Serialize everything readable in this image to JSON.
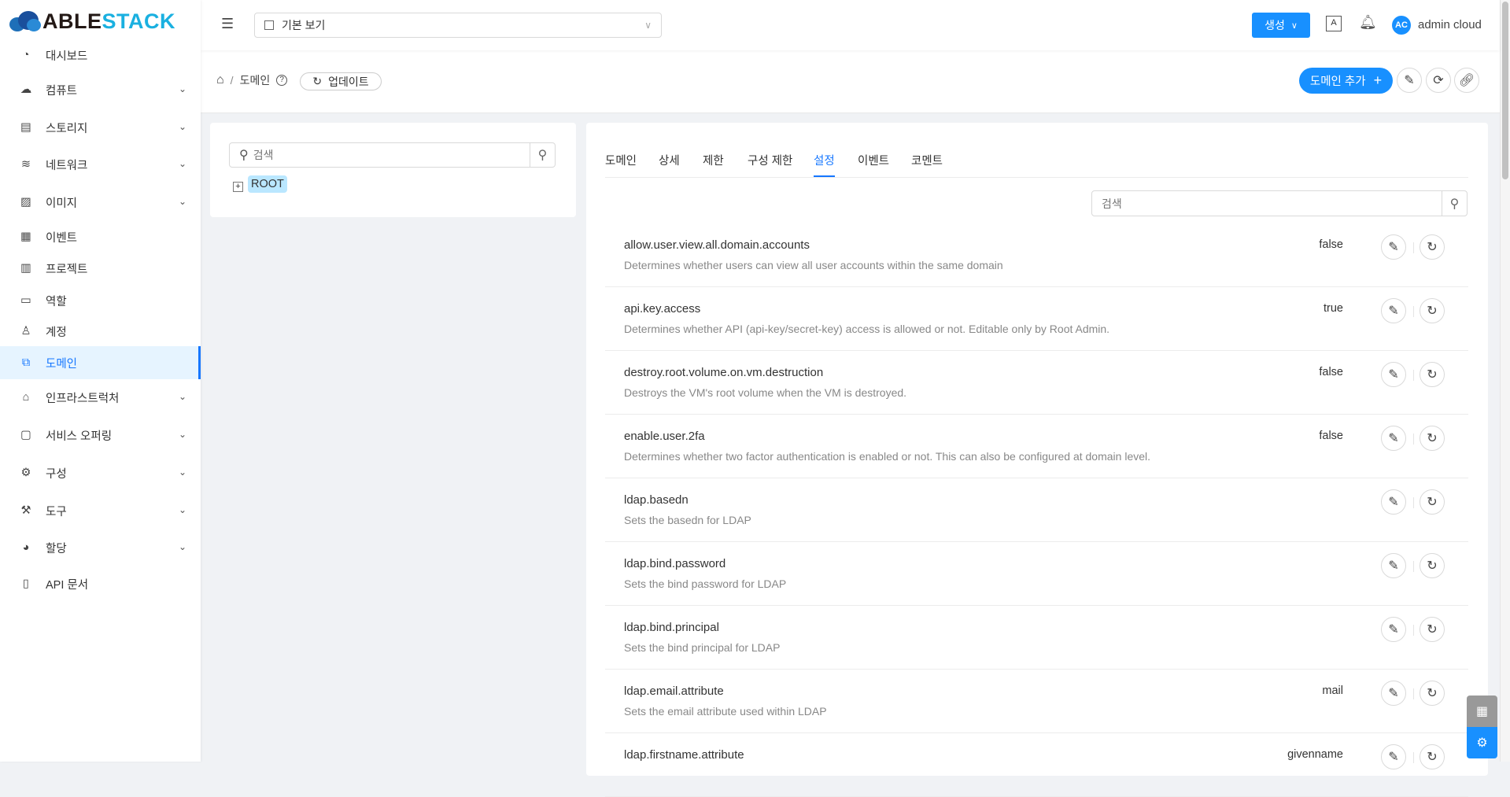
{
  "logo": {
    "part1": "ABLE",
    "part2": "STACK"
  },
  "sidebar": {
    "items": [
      {
        "label": "대시보드",
        "icon": "dashboard-icon",
        "chevron": false
      },
      {
        "label": "컴퓨트",
        "icon": "cloud-icon",
        "chevron": true
      },
      {
        "label": "스토리지",
        "icon": "storage-icon",
        "chevron": true
      },
      {
        "label": "네트워크",
        "icon": "wifi-icon",
        "chevron": true
      },
      {
        "label": "이미지",
        "icon": "picture-icon",
        "chevron": true
      },
      {
        "label": "이벤트",
        "icon": "calendar-icon",
        "chevron": false
      },
      {
        "label": "프로젝트",
        "icon": "project-icon",
        "chevron": false
      },
      {
        "label": "역할",
        "icon": "idcard-icon",
        "chevron": false
      },
      {
        "label": "계정",
        "icon": "user-icon",
        "chevron": false
      },
      {
        "label": "도메인",
        "icon": "block-icon",
        "chevron": false,
        "active": true
      },
      {
        "label": "인프라스트럭처",
        "icon": "bank-icon",
        "chevron": true
      },
      {
        "label": "서비스 오퍼링",
        "icon": "shopping-icon",
        "chevron": true
      },
      {
        "label": "구성",
        "icon": "setting-icon",
        "chevron": true
      },
      {
        "label": "도구",
        "icon": "tool-icon",
        "chevron": true
      },
      {
        "label": "할당",
        "icon": "pie-chart-icon",
        "chevron": true
      },
      {
        "label": "API 문서",
        "icon": "read-icon",
        "chevron": false
      }
    ]
  },
  "header": {
    "project_select": "기본 보기",
    "create_label": "생성",
    "user_initials": "AC",
    "user_name": "admin cloud"
  },
  "breadcrumb": {
    "current": "도메인",
    "update_label": "업데이트",
    "add_domain_label": "도메인 추가"
  },
  "tree": {
    "search_placeholder": "검색",
    "root_label": "ROOT"
  },
  "tabs": [
    "도메인",
    "상세",
    "제한",
    "구성 제한",
    "설정",
    "이벤트",
    "코멘트"
  ],
  "active_tab": "설정",
  "settings_search_placeholder": "검색",
  "settings": [
    {
      "name": "allow.user.view.all.domain.accounts",
      "description": "Determines whether users can view all user accounts within the same domain",
      "value": "false"
    },
    {
      "name": "api.key.access",
      "description": "Determines whether API (api-key/secret-key) access is allowed or not. Editable only by Root Admin.",
      "value": "true"
    },
    {
      "name": "destroy.root.volume.on.vm.destruction",
      "description": "Destroys the VM's root volume when the VM is destroyed.",
      "value": "false"
    },
    {
      "name": "enable.user.2fa",
      "description": "Determines whether two factor authentication is enabled or not. This can also be configured at domain level.",
      "value": "false"
    },
    {
      "name": "ldap.basedn",
      "description": "Sets the basedn for LDAP",
      "value": ""
    },
    {
      "name": "ldap.bind.password",
      "description": "Sets the bind password for LDAP",
      "value": ""
    },
    {
      "name": "ldap.bind.principal",
      "description": "Sets the bind principal for LDAP",
      "value": ""
    },
    {
      "name": "ldap.email.attribute",
      "description": "Sets the email attribute used within LDAP",
      "value": "mail"
    },
    {
      "name": "ldap.firstname.attribute",
      "description": "",
      "value": "givenname"
    }
  ],
  "colors": {
    "primary": "#1890ff",
    "active_bg": "#e6f4ff",
    "root_bg": "#bae7ff"
  }
}
